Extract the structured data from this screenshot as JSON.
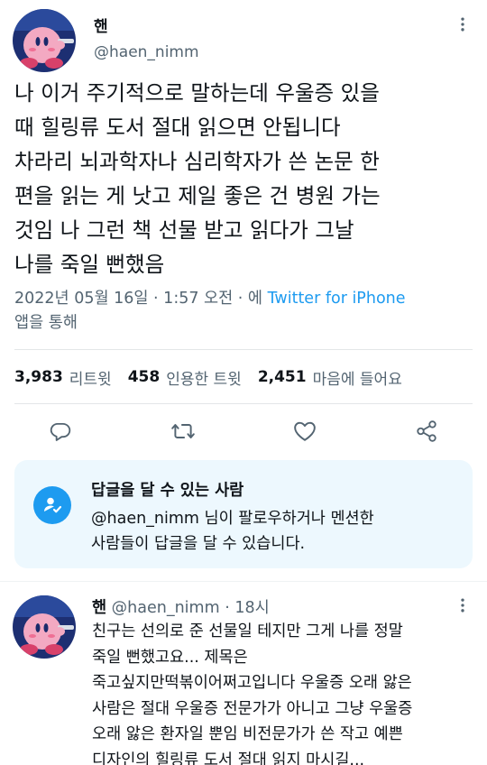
{
  "author": {
    "display_name": "핸",
    "handle": "@haen_nimm"
  },
  "tweet": {
    "lines": [
      "나 이거 주기적으로 말하는데 우울증 있을",
      "때 힐링류 도서 절대 읽으면 안됩니다",
      "차라리 뇌과학자나 심리학자가 쓴 논문 한",
      "편을 읽는 게 낫고 제일 좋은 건 병원 가는",
      "것임 나 그런 책 선물 받고 읽다가 그날",
      "나를 죽일 뻔했음"
    ],
    "timestamp": "2022년 05월 16일 · 1:57 오전 · 에 ",
    "source": "Twitter for iPhone",
    "source_suffix": "앱을 통해"
  },
  "stats": {
    "retweets_count": "3,983",
    "retweets_label": "리트윗",
    "quotes_count": "458",
    "quotes_label": "인용한 트윗",
    "likes_count": "2,451",
    "likes_label": "마음에 들어요"
  },
  "actions": [
    "reply-icon",
    "retweet-icon",
    "like-icon",
    "share-icon"
  ],
  "reply_restriction": {
    "title": "답글을 달 수 있는 사람",
    "body_line1": "@haen_nimm 님이 팔로우하거나 멘션한",
    "body_line2": "사람들이 답글을 달 수 있습니다."
  },
  "reply": {
    "display_name": "핸",
    "handle_time": " @haen_nimm · 18시",
    "lines": [
      "친구는 선의로 준 선물일 테지만 그게 나를 정말",
      "죽일 뻔했고요... 제목은",
      "죽고싶지만떡볶이어쩌고입니다 우울증 오래 앓은",
      "사람은 절대 우울증 전문가가 아니고 그냥 우울증",
      "오래 앓은 환자일 뿐임 비전문가가 쓴 작고 예쁜",
      "디자인의 힐링류 도서 절대 읽지 마시길..."
    ]
  },
  "colors": {
    "accent": "#1d9bf0",
    "secondary_text": "#536471",
    "reply_box_bg": "#edf8fe"
  }
}
